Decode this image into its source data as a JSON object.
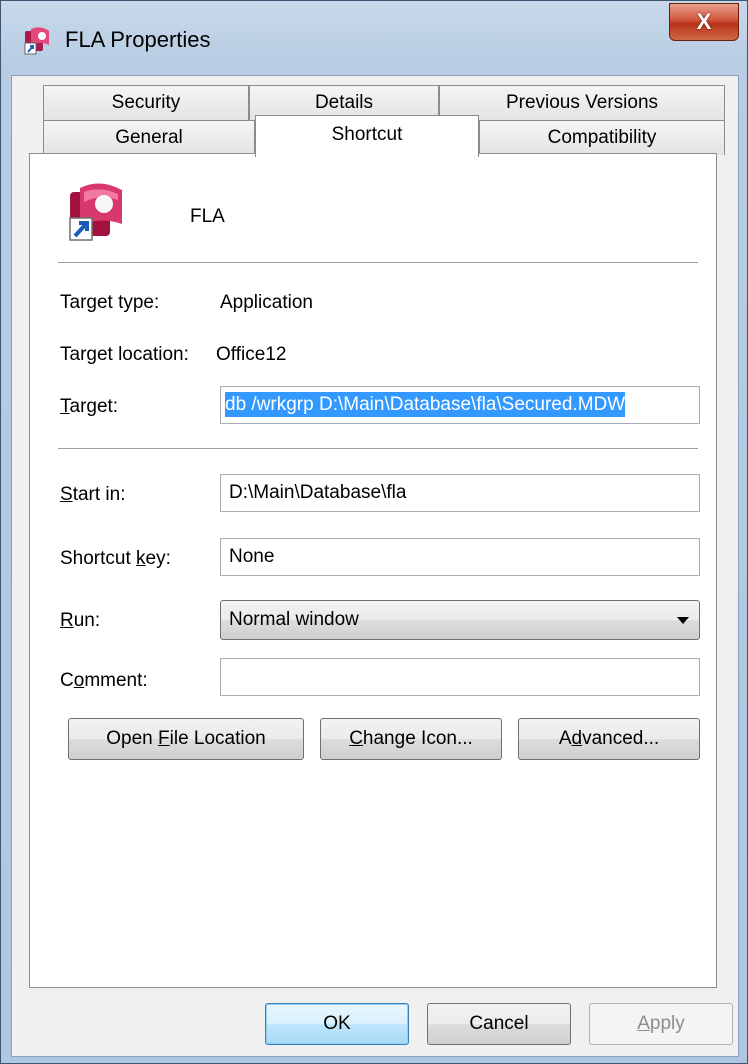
{
  "window": {
    "title": "FLA Properties",
    "close_label": "X",
    "app_icon": "access-shortcut-icon"
  },
  "tabs": {
    "row1": [
      "Security",
      "Details",
      "Previous Versions"
    ],
    "row2": [
      "General",
      "Shortcut",
      "Compatibility"
    ],
    "active": "Shortcut"
  },
  "shortcut": {
    "name": "FLA",
    "icon": "access-app-icon",
    "target_type_label": "Target type:",
    "target_type_value": "Application",
    "target_location_label": "Target location:",
    "target_location_value": "Office12",
    "target_label_pre": "",
    "target_label_u": "T",
    "target_label_post": "arget:",
    "target_value": "db /wrkgrp D:\\Main\\Database\\fla\\Secured.MDW",
    "start_in_label_u": "S",
    "start_in_label_post": "tart in:",
    "start_in_value": "D:\\Main\\Database\\fla",
    "shortcut_key_label_pre": "Shortcut ",
    "shortcut_key_label_u": "k",
    "shortcut_key_label_post": "ey:",
    "shortcut_key_value": "None",
    "run_label_u": "R",
    "run_label_post": "un:",
    "run_value": "Normal window",
    "comment_label_pre": "C",
    "comment_label_u": "o",
    "comment_label_post": "mment:",
    "comment_value": ""
  },
  "buttons": {
    "open_file_location_pre": "Open ",
    "open_file_location_u": "F",
    "open_file_location_post": "ile Location",
    "change_icon_u": "C",
    "change_icon_post": "hange Icon...",
    "advanced_pre": "A",
    "advanced_u": "d",
    "advanced_post": "vanced...",
    "ok": "OK",
    "cancel": "Cancel",
    "apply_u": "A",
    "apply_post": "pply"
  }
}
